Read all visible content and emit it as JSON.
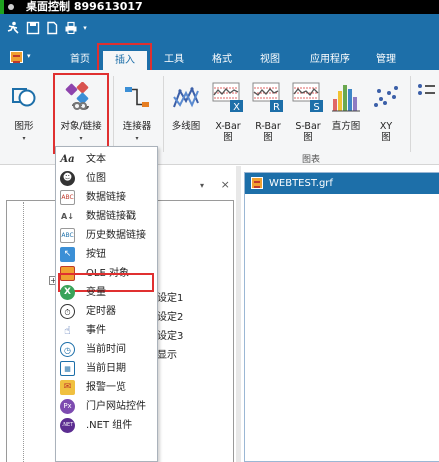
{
  "window": {
    "title": "桌面控制 899613017"
  },
  "ribbon": {
    "tabs": [
      {
        "label": "首页"
      },
      {
        "label": "插入"
      },
      {
        "label": "工具"
      },
      {
        "label": "格式"
      },
      {
        "label": "视图"
      },
      {
        "label": "应用程序"
      },
      {
        "label": "管理"
      }
    ],
    "active_tab": "插入",
    "buttons": [
      {
        "label": "图形"
      },
      {
        "label": "对象/链接"
      },
      {
        "label": "连接器"
      },
      {
        "label": "多线图"
      },
      {
        "label": "X-Bar",
        "sub": "图"
      },
      {
        "label": "R-Bar",
        "sub": "图"
      },
      {
        "label": "S-Bar",
        "sub": "图"
      },
      {
        "label": "直方图"
      },
      {
        "label": "XY",
        "sub": "图"
      }
    ],
    "group_label": "图表",
    "dropdown_glyph": "▾"
  },
  "menu": {
    "items": [
      {
        "label": "文本",
        "icon": "text-icon"
      },
      {
        "label": "位图",
        "icon": "bitmap-icon"
      },
      {
        "label": "数据链接",
        "icon": "data-link-icon"
      },
      {
        "label": "数据链接戳",
        "icon": "data-link-stamp-icon"
      },
      {
        "label": "历史数据链接",
        "icon": "history-data-link-icon"
      },
      {
        "label": "按钮",
        "icon": "button-icon"
      },
      {
        "label": "OLE 对象",
        "icon": "ole-object-icon"
      },
      {
        "label": "变量",
        "icon": "variable-icon"
      },
      {
        "label": "定时器",
        "icon": "timer-icon"
      },
      {
        "label": "事件",
        "icon": "event-icon"
      },
      {
        "label": "当前时间",
        "icon": "clock-icon"
      },
      {
        "label": "当前日期",
        "icon": "calendar-icon"
      },
      {
        "label": "报警一览",
        "icon": "alarm-icon"
      },
      {
        "label": "门户网站控件",
        "icon": "portal-icon"
      },
      {
        "label": ".NET 组件",
        "icon": "dotnet-icon"
      }
    ],
    "highlighted": "OLE 对象"
  },
  "tree": {
    "items": [
      {
        "label": "设定1"
      },
      {
        "label": "设定2"
      },
      {
        "label": "设定3"
      },
      {
        "label": "显示"
      }
    ]
  },
  "pane": {
    "pin": "▾",
    "close": "×"
  },
  "document": {
    "title": "WEBTEST.grf"
  },
  "colors": {
    "ribbon_blue": "#1d6fa9",
    "highlight_red": "#e03030",
    "ribbon_bg": "#f5f6f7"
  }
}
